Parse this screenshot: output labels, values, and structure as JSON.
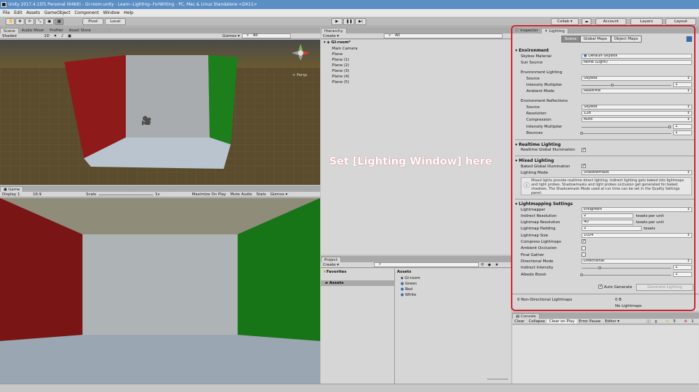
{
  "window": {
    "title": "Unity 2017.4.15f1 Personal (64bit) - GI-room.unity - Learn--Lighting--ForWriting - PC, Mac & Linux Standalone <DX11>"
  },
  "menu": [
    "File",
    "Edit",
    "Assets",
    "GameObject",
    "Component",
    "Window",
    "Help"
  ],
  "toolbar": {
    "pivot": "Pivot",
    "local": "Local",
    "collab": "Collab ▾",
    "account": "Account",
    "layers": "Layers",
    "layout": "Layout"
  },
  "scene": {
    "tabs": [
      "Scene",
      "Audio Mixer",
      "Profiler",
      "Asset Store"
    ],
    "shading": "Shaded",
    "mode2d": "2D",
    "gizmos": "Gizmos ▾",
    "search": "All",
    "persp": "< Persp"
  },
  "game": {
    "tab": "Game",
    "display": "Display 1",
    "aspect": "16:9",
    "scale_label": "Scale",
    "scale_value": "1x",
    "maximize": "Maximize On Play",
    "mute": "Mute Audio",
    "stats": "Stats",
    "gizmos": "Gizmos ▾"
  },
  "hierarchy": {
    "tab": "Hierarchy",
    "create": "Create ▾",
    "search": "All",
    "root": "GI-room*",
    "items": [
      "Main Camera",
      "Plane",
      "Plane (1)",
      "Plane (2)",
      "Plane (3)",
      "Plane (4)",
      "Plane (5)"
    ]
  },
  "project": {
    "tab": "Project",
    "create": "Create ▾",
    "favorites": "Favorites",
    "assets_folder": "Assets",
    "assets_header": "Assets",
    "items": [
      "GI-room",
      "Green",
      "Red",
      "White"
    ]
  },
  "annotation": "Set [Lighting Window] here",
  "inspector": {
    "tabs": [
      "Inspector",
      "Lighting"
    ],
    "subtabs": [
      "Scene",
      "Global Maps",
      "Object Maps"
    ]
  },
  "environment": {
    "header": "Environment",
    "skybox_label": "Skybox Material",
    "skybox_value": "Default-Skybox",
    "sun_label": "Sun Source",
    "sun_value": "None (Light)",
    "env_lighting": "Environment Lighting",
    "source_label": "Source",
    "source_value": "Skybox",
    "intensity_label": "Intensity Multiplier",
    "intensity_value": "1",
    "ambient_label": "Ambient Mode",
    "ambient_value": "Realtime",
    "env_reflections": "Environment Reflections",
    "refl_source_label": "Source",
    "refl_source_value": "Skybox",
    "resolution_label": "Resolution",
    "resolution_value": "128",
    "compression_label": "Compression",
    "compression_value": "Auto",
    "refl_intensity_label": "Intensity Multiplier",
    "refl_intensity_value": "1",
    "bounces_label": "Bounces",
    "bounces_value": "1"
  },
  "realtime": {
    "header": "Realtime Lighting",
    "gi_label": "Realtime Global Illumination"
  },
  "mixed": {
    "header": "Mixed Lighting",
    "baked_label": "Baked Global Illumination",
    "mode_label": "Lighting Mode",
    "mode_value": "Shadowmask",
    "help": "Mixed lights provide realtime direct lighting. Indirect lighting gets baked into lightmaps and light probes. Shadowmasks and light probes occlusion get generated for baked shadows. The Shadowmask Mode used at run time can be set in the Quality Settings panel."
  },
  "lightmapping": {
    "header": "Lightmapping Settings",
    "lightmapper_label": "Lightmapper",
    "lightmapper_value": "Enlighten",
    "indirect_res_label": "Indirect Resolution",
    "indirect_res_value": "2",
    "lightmap_res_label": "Lightmap Resolution",
    "lightmap_res_value": "40",
    "padding_label": "Lightmap Padding",
    "padding_value": "2",
    "size_label": "Lightmap Size",
    "size_value": "1024",
    "compress_label": "Compress Lightmaps",
    "ao_label": "Ambient Occlusion",
    "final_gather_label": "Final Gather",
    "dir_mode_label": "Directional Mode",
    "dir_mode_value": "Directional",
    "indirect_intensity_label": "Indirect Intensity",
    "indirect_intensity_value": "1",
    "albedo_label": "Albedo Boost",
    "albedo_value": "1",
    "texels_per_unit": "texels per unit",
    "texels": "texels"
  },
  "bake": {
    "auto_label": "Auto Generate",
    "generate_label": "Generate Lighting",
    "stats_left": "0 Non-Directional Lightmaps",
    "stats_right": "0 B",
    "no_lightmaps": "No Lightmaps"
  },
  "console": {
    "tab": "Console",
    "clear": "Clear",
    "collapse": "Collapse",
    "clear_on_play": "Clear on Play",
    "error_pause": "Error Pause",
    "editor": "Editor ▾",
    "count_info": "0",
    "count_warn": "5",
    "count_err": "1"
  },
  "colors": {
    "annotation": "#ffffff",
    "highlight": "#d01f2a",
    "red_wall": "#9b1414",
    "green_wall": "#138a13"
  }
}
